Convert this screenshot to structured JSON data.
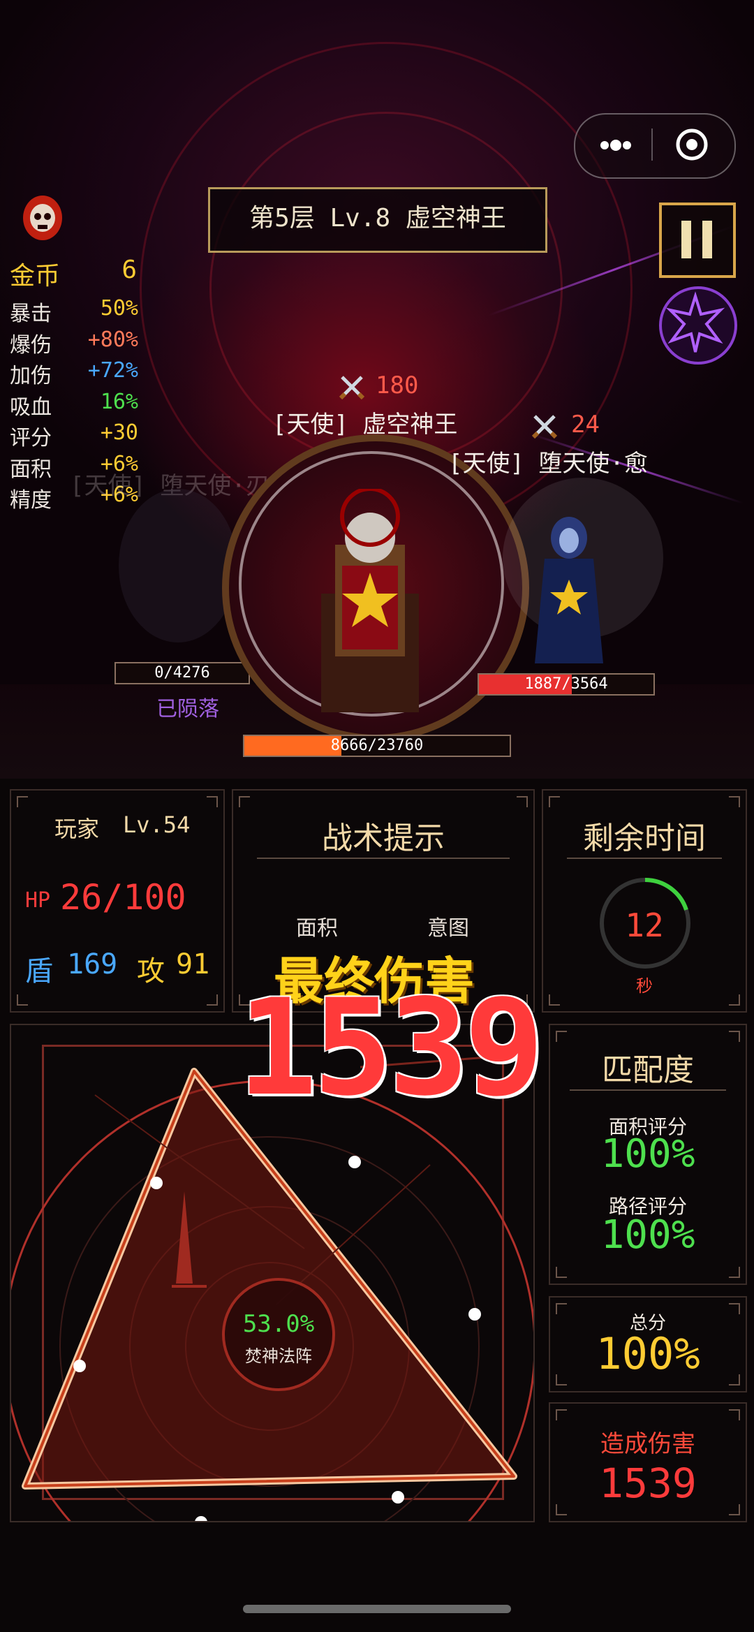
{
  "stage": {
    "title": "第5层  Lv.8 虚空神王"
  },
  "stats": {
    "gold": {
      "label": "金币",
      "value": "6"
    },
    "items": [
      {
        "label": "暴击",
        "value": "50%",
        "color": "#ffcc33"
      },
      {
        "label": "爆伤",
        "value": "+80%",
        "color": "#ff7a5a"
      },
      {
        "label": "加伤",
        "value": "+72%",
        "color": "#4aa8ff"
      },
      {
        "label": "吸血",
        "value": "16%",
        "color": "#4ee04e"
      },
      {
        "label": "评分",
        "value": "+30",
        "color": "#ffcc33"
      },
      {
        "label": "面积",
        "value": "+6%",
        "color": "#ffcc33"
      },
      {
        "label": "精度",
        "value": "+6%",
        "color": "#ffcc33"
      }
    ]
  },
  "enemies": {
    "boss": {
      "name": "[天使] 虚空神王",
      "attack": "180",
      "hp": "8666/23760",
      "hp_fraction": 0.365
    },
    "right": {
      "name": "[天使] 堕天使·愈",
      "attack": "24",
      "hp": "1887/3564",
      "hp_fraction": 0.53
    },
    "left": {
      "name": "[天使] 堕天使·刃",
      "hp": "0/4276",
      "status": "已陨落"
    }
  },
  "player": {
    "name": "玩家",
    "level": "Lv.54",
    "hp_label": "HP",
    "hp": "26/100",
    "shield_label": "盾",
    "shield": "169",
    "attack_label": "攻",
    "attack": "91"
  },
  "tactics": {
    "title": "战术提示",
    "col1": "面积",
    "col2": "意图"
  },
  "timer": {
    "title": "剩余时间",
    "value": "12",
    "unit": "秒",
    "progress": 0.2
  },
  "final_damage": {
    "label": "最终伤害",
    "value": "1539"
  },
  "array": {
    "percent": "53.0%",
    "name": "焚神法阵"
  },
  "match": {
    "title": "匹配度",
    "area_label": "面积评分",
    "area_value": "100%",
    "path_label": "路径评分",
    "path_value": "100%"
  },
  "total": {
    "label": "总分",
    "value": "100%"
  },
  "damage": {
    "label": "造成伤害",
    "value": "1539"
  },
  "colors": {
    "accent_gold": "#d8a64a",
    "hp_red": "#e83030",
    "boss_bar": "#ff6a20",
    "purple": "#8a3fd0"
  },
  "icons": [
    "skull-icon",
    "more-icon",
    "target-icon",
    "pause-icon",
    "star-icon",
    "sword-icon"
  ]
}
